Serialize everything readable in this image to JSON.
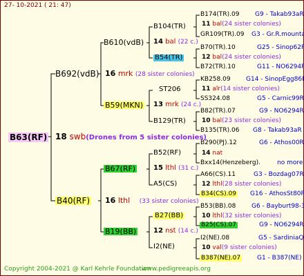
{
  "header": "27- 10-2021 ( 21: 47)",
  "footer_left": "Copyright 2004-2021 @ Karl Kehrle Foundation",
  "footer_right": "www.pedigreeapis.org",
  "root": {
    "name": "B63(RF)",
    "count": "18",
    "tag": "swb",
    "note": "(Drones from 5 sister colonies)"
  },
  "gen1": [
    {
      "name": "B692(vdB)",
      "count": "16",
      "tag": "mrk",
      "note": "(28 sister colonies)"
    },
    {
      "name": "B40(RF)",
      "count": "16",
      "tag": "lthl",
      "note": "(33 sister colonies)"
    }
  ],
  "gen2": [
    {
      "name": "B610(vdB)",
      "count": "14",
      "tag": "bal",
      "note": "(22 c.)"
    },
    {
      "name": "B59(MKN)",
      "count": "13",
      "tag": "mrk",
      "note": "(24 c.)"
    },
    {
      "name": "B67(RF)",
      "count": "15",
      "tag": "lthl",
      "note": "(31 c.)"
    },
    {
      "name": "B19(BB)",
      "count": "12",
      "tag": "nst",
      "note": "(14 c.)"
    }
  ],
  "gen3": [
    {
      "name": "B104(TR)"
    },
    {
      "name": "B54(TR)"
    },
    {
      "name": "ST206"
    },
    {
      "name": "B129(TR)"
    },
    {
      "name": "B52(RF)"
    },
    {
      "name": "A5(CS)"
    },
    {
      "name": "B27(BB)"
    },
    {
      "name": "I2(NE)"
    }
  ],
  "gen4": [
    {
      "top": "B174(TR).09",
      "topid": "G9 - Takab93aR",
      "count": "11",
      "tag": "bal",
      "note": "(24 sister colonies)",
      "bot": "GR109(TR).09",
      "botid": "G3 - Gr.R.mounta"
    },
    {
      "top": "B70(TR).10",
      "topid": "G25 - Sinop62R",
      "count": "12",
      "tag": "bal",
      "note": "(24 sister colonies)",
      "bot": "B72(TR).10",
      "botid": "G11 - NO6294R"
    },
    {
      "top": "KB258.09",
      "topid": "G14 - SinopEgg86R",
      "count": "11",
      "tag": "alr",
      "note": "(14 sister colonies)",
      "bot": "SS324.08",
      "botid": "G5 - Carnic99R"
    },
    {
      "top": "B82(TR).07",
      "topid": "G9 - NO6294R",
      "count": "10",
      "tag": "bal",
      "note": "(23 sister colonies)",
      "bot": "B135(TR).06",
      "botid": "G8 - Takab93aR"
    },
    {
      "top": "B290(PJ).12",
      "topid": "G6 - Athos00R",
      "count": "14",
      "tag": "nat",
      "note": "",
      "bot": "Bxx14(Henzeberg).",
      "botid": "no more"
    },
    {
      "top": "A66(CS).11",
      "topid": "G3 - Bozdag07R",
      "count": "12",
      "tag": "lthl",
      "note": "(28 sister colonies)",
      "bot": "B34(CS).09",
      "botid": "G16 - AthosSt80R"
    },
    {
      "top": "B53(BB).08",
      "topid": "G6 - Bayburt98-3",
      "count": "10",
      "tag": "lthl",
      "note": "(32 sister colonies)",
      "bot": "B25(CS).07",
      "botid": "G9 - NO6294R"
    },
    {
      "top": "I2(NE).08",
      "topid": "G5 - SardiniaQ",
      "count": "10",
      "tag": "val",
      "note": "(9 sister colonies)",
      "bot": "B387(NE).07",
      "botid": "G1 - B387(NE)"
    }
  ]
}
